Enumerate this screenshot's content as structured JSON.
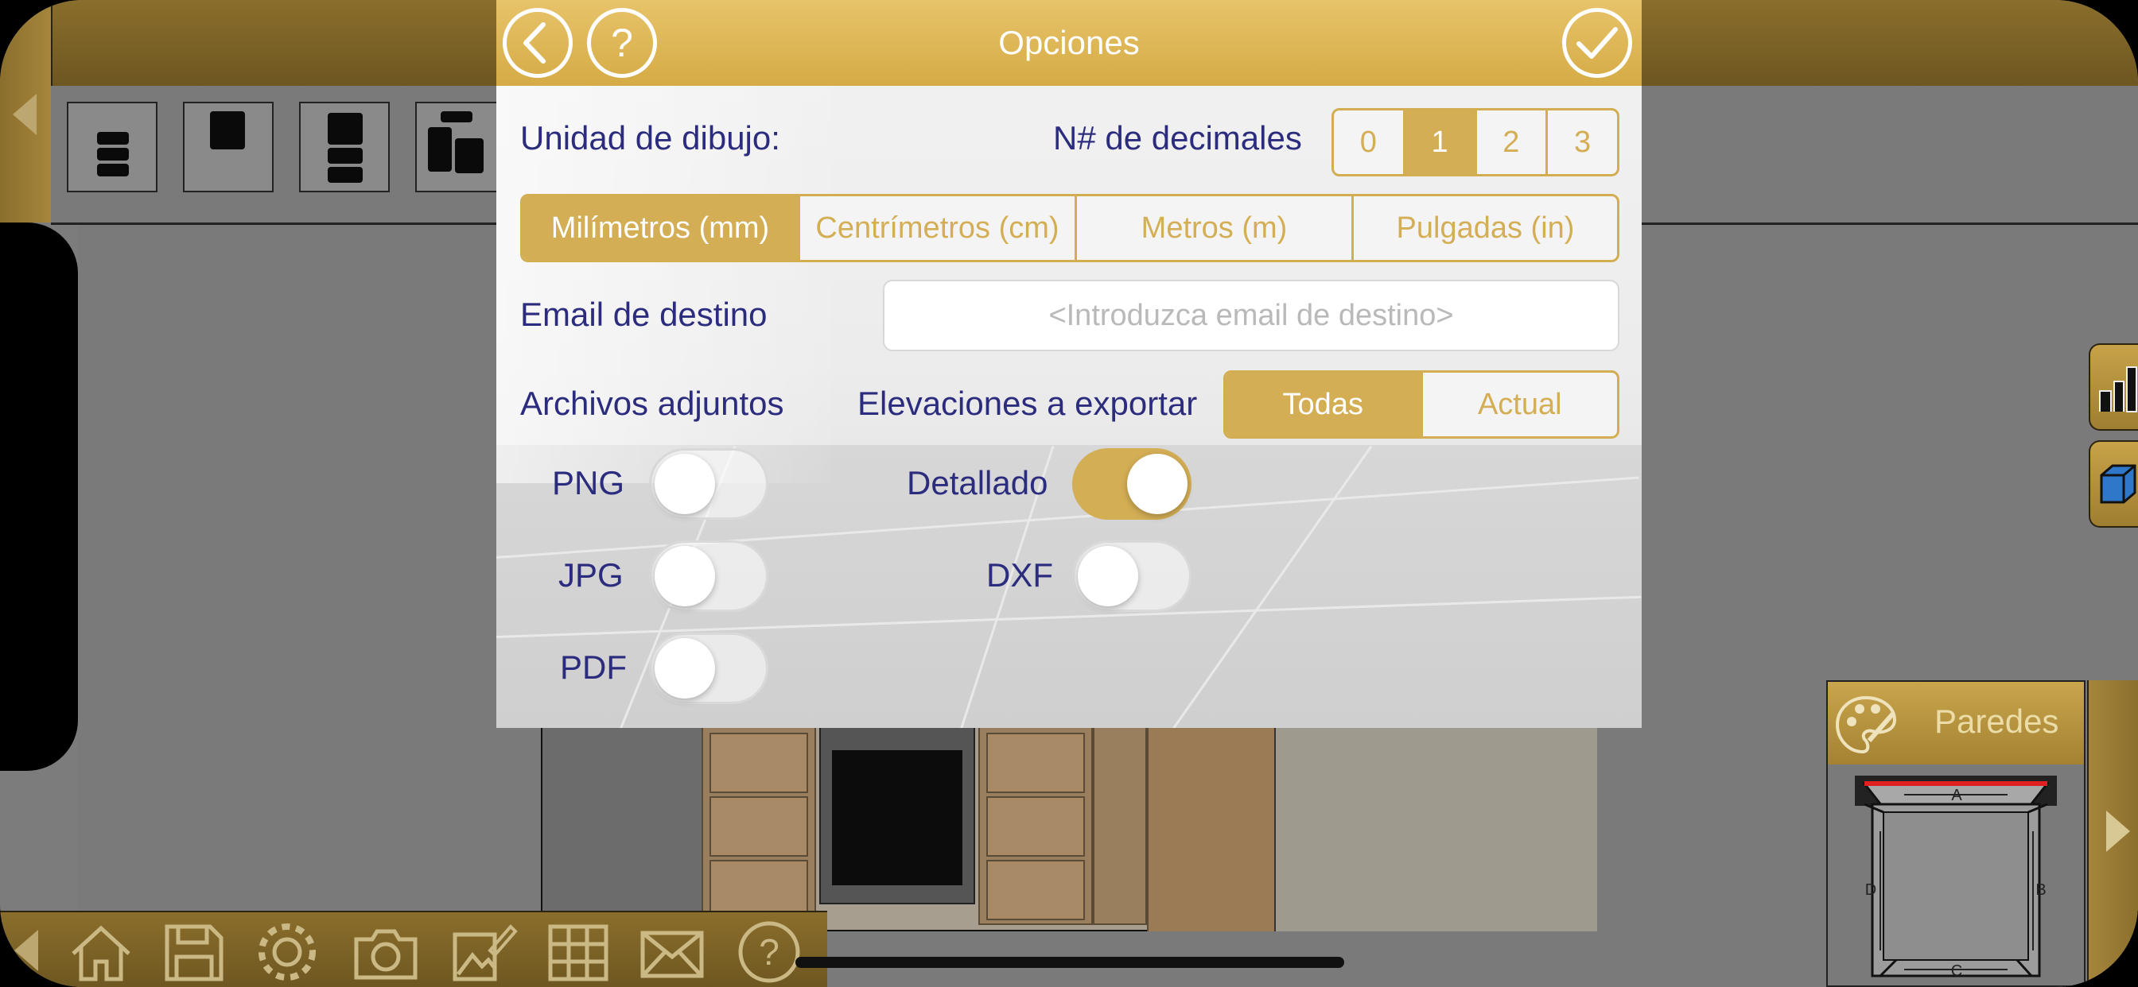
{
  "dialog": {
    "title": "Opciones",
    "back_label": "‹",
    "help_label": "?",
    "confirm_label": "✓"
  },
  "units": {
    "label": "Unidad de dibujo:",
    "decimals_label": "N# de decimales",
    "decimals_options": [
      "0",
      "1",
      "2",
      "3"
    ],
    "decimals_selected": "1",
    "options": [
      "Milímetros (mm)",
      "Centrímetros (cm)",
      "Metros (m)",
      "Pulgadas (in)"
    ],
    "selected": "Milímetros (mm)"
  },
  "email": {
    "label": "Email de destino",
    "placeholder": "<Introduzca email de destino>",
    "value": ""
  },
  "attachments": {
    "label": "Archivos adjuntos",
    "elevations_label": "Elevaciones a exportar",
    "elevations_options": [
      "Todas",
      "Actual"
    ],
    "elevations_selected": "Todas",
    "toggles": [
      {
        "label": "PNG",
        "on": false
      },
      {
        "label": "JPG",
        "on": false
      },
      {
        "label": "PDF",
        "on": false
      },
      {
        "label": "Detallado",
        "on": true
      },
      {
        "label": "DXF",
        "on": false
      }
    ]
  },
  "side_panel": {
    "title": "Paredes",
    "wall_labels": [
      "A",
      "B",
      "C",
      "D"
    ]
  },
  "colors": {
    "accent": "#d4ae55",
    "label_text": "#2c2c7f",
    "toolbar": "#8a6e2c"
  },
  "icons": {
    "bottom_toolbar": [
      "home-icon",
      "save-icon",
      "gear-icon",
      "camera-icon",
      "image-edit-icon",
      "grid-icon",
      "mail-icon",
      "help-icon"
    ]
  }
}
